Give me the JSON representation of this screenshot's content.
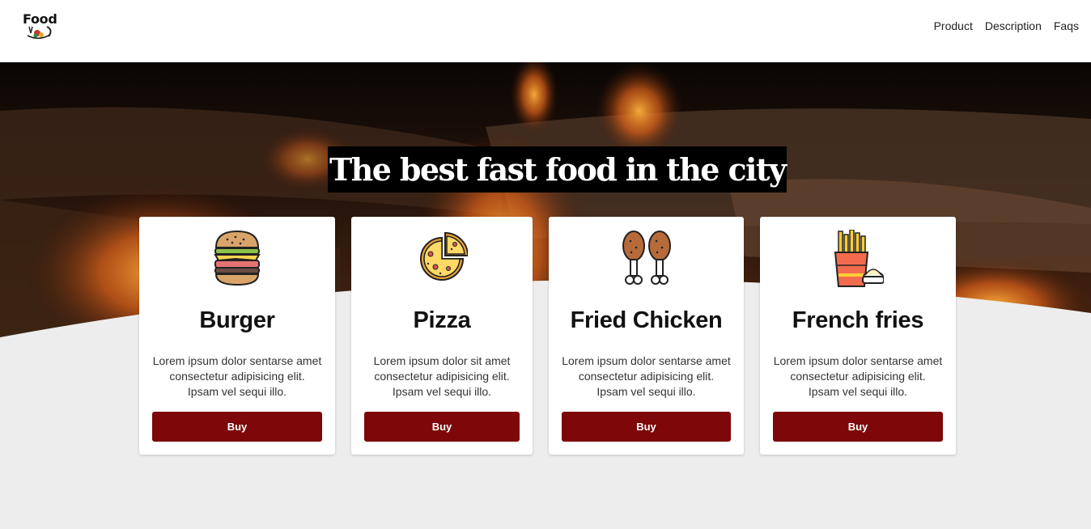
{
  "brand": {
    "logo_text": "Food"
  },
  "nav": {
    "links": [
      {
        "label": "Product"
      },
      {
        "label": "Description"
      },
      {
        "label": "Faqs"
      }
    ]
  },
  "hero": {
    "headline": "The best fast food in the city"
  },
  "cards": [
    {
      "icon": "burger-icon",
      "title": "Burger",
      "lines": [
        "Lorem ipsum dolor sentarse amet",
        "consectetur adipisicing elit.",
        "Ipsam vel sequi illo."
      ],
      "button": "Buy"
    },
    {
      "icon": "pizza-icon",
      "title": "Pizza",
      "lines": [
        "Lorem ipsum dolor sit amet",
        "consectetur adipisicing elit.",
        "Ipsam vel sequi illo."
      ],
      "button": "Buy"
    },
    {
      "icon": "chicken-leg-icon",
      "title": "Fried Chicken",
      "lines": [
        "Lorem ipsum dolor sentarse amet",
        "consectetur adipisicing elit.",
        "Ipsam vel sequi illo."
      ],
      "button": "Buy"
    },
    {
      "icon": "french-fries-icon",
      "title": "French fries",
      "lines": [
        "Lorem ipsum dolor sentarse amet",
        "consectetur adipisicing elit.",
        "Ipsam vel sequi illo."
      ],
      "button": "Buy"
    }
  ],
  "colors": {
    "button_bg": "#7d0709",
    "page_bg": "#ededed",
    "nav_bg": "#ffffff",
    "headline_bg": "#000000"
  }
}
